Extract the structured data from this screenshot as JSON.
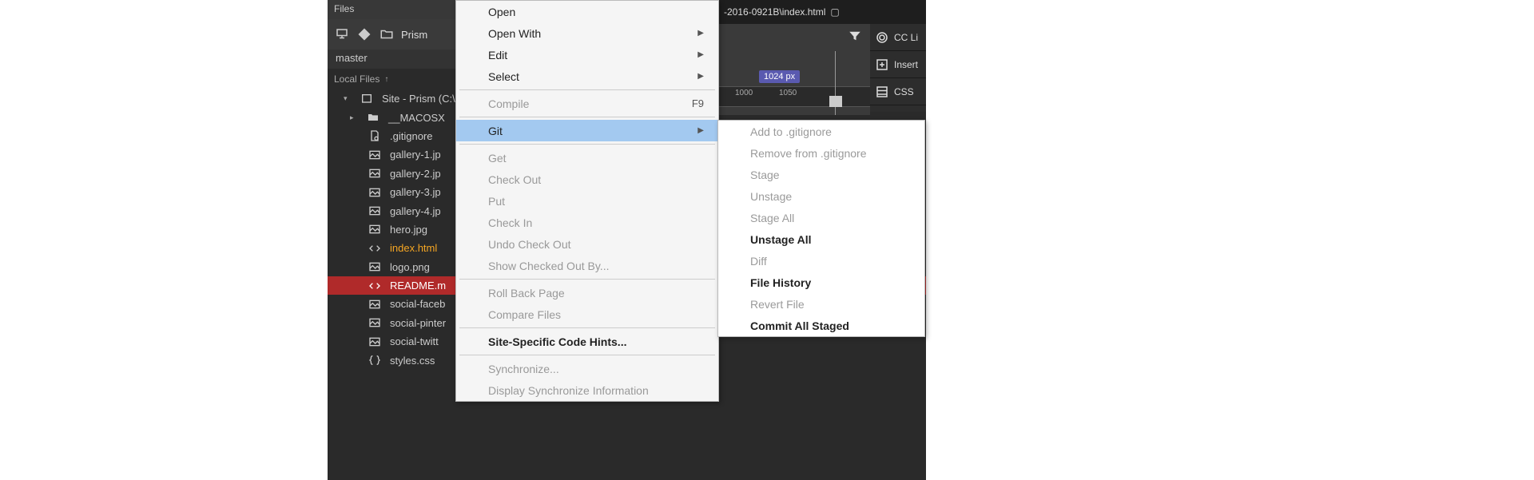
{
  "panel_title": "Files",
  "site_folder": "Prism",
  "branch": "master",
  "local_files_label": "Local Files",
  "tree": {
    "root": "Site - Prism (C:\\",
    "macosx": "__MACOSX",
    "items": [
      ".gitignore",
      "gallery-1.jp",
      "gallery-2.jp",
      "gallery-3.jp",
      "gallery-4.jp",
      "hero.jpg",
      "index.html",
      "logo.png",
      "README.m",
      "social-faceb",
      "social-pinter",
      "social-twitt",
      "styles.css"
    ]
  },
  "tab_path": "-2016-0921B\\index.html",
  "side_panels": [
    "CC Li",
    "Insert",
    "CSS "
  ],
  "ruler": {
    "badge": "1024  px",
    "ticks": [
      "1000",
      "1050"
    ]
  },
  "context_menu": {
    "open": "Open",
    "open_with": "Open With",
    "edit": "Edit",
    "select": "Select",
    "compile": "Compile",
    "compile_key": "F9",
    "git": "Git",
    "get": "Get",
    "check_out": "Check Out",
    "put": "Put",
    "check_in": "Check In",
    "undo_check_out": "Undo Check Out",
    "show_checked_out": "Show Checked Out By...",
    "roll_back": "Roll Back Page",
    "compare": "Compare Files",
    "code_hints": "Site-Specific Code Hints...",
    "synchronize": "Synchronize...",
    "display_sync": "Display Synchronize Information"
  },
  "git_submenu": {
    "add_ignore": "Add to .gitignore",
    "remove_ignore": "Remove from .gitignore",
    "stage": "Stage",
    "unstage": "Unstage",
    "stage_all": "Stage All",
    "unstage_all": "Unstage All",
    "diff": "Diff",
    "file_history": "File History",
    "revert": "Revert File",
    "commit_all": "Commit All Staged"
  }
}
